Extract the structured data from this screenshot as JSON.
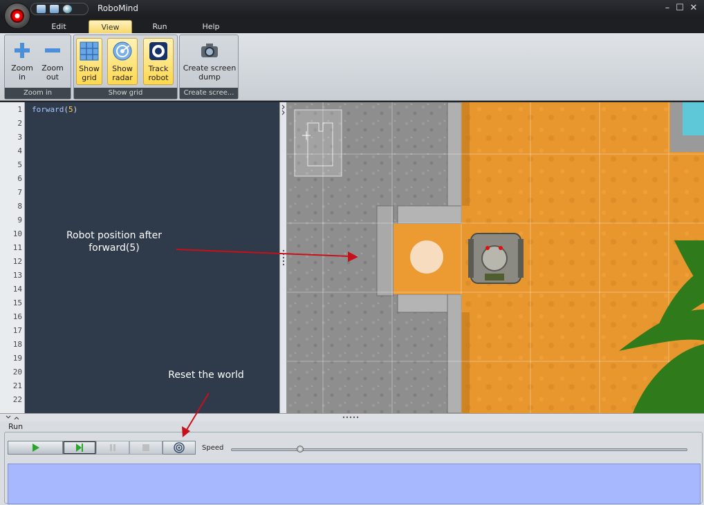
{
  "app": {
    "title": "RoboMind"
  },
  "window_controls": {
    "minimize": "–",
    "maximize": "☐",
    "close": "✕"
  },
  "menu": {
    "tabs": [
      "Edit",
      "View",
      "Run",
      "Help"
    ],
    "active": "View"
  },
  "ribbon": {
    "groups": [
      {
        "name": "Zoom in",
        "buttons": [
          {
            "label1": "Zoom",
            "label2": "in",
            "icon": "plus-icon"
          },
          {
            "label1": "Zoom",
            "label2": "out",
            "icon": "minus-icon"
          }
        ]
      },
      {
        "name": "Show grid",
        "buttons": [
          {
            "label1": "Show",
            "label2": "grid",
            "icon": "grid-icon",
            "active": true
          },
          {
            "label1": "Show",
            "label2": "radar",
            "icon": "radar-icon",
            "active": true
          },
          {
            "label1": "Track",
            "label2": "robot",
            "icon": "eye-icon",
            "active": true
          }
        ]
      },
      {
        "name": "Create scree...",
        "buttons": [
          {
            "label1": "Create screen",
            "label2": "dump",
            "icon": "camera-icon"
          }
        ]
      }
    ]
  },
  "editor": {
    "line_numbers": [
      "1",
      "2",
      "3",
      "4",
      "5",
      "6",
      "7",
      "8",
      "9",
      "10",
      "11",
      "12",
      "13",
      "14",
      "15",
      "16",
      "17",
      "18",
      "19",
      "20",
      "21",
      "22"
    ],
    "code": {
      "keyword": "forward",
      "open": "(",
      "arg": "5",
      "close": ")"
    }
  },
  "annotations": {
    "robot_position_line1": "Robot position after",
    "robot_position_line2": "forward(5)",
    "reset_world": "Reset the world"
  },
  "run_panel": {
    "label": "Run",
    "speed_label": "Speed",
    "speed_level": 0.15,
    "buttons": [
      "play-icon",
      "step-icon",
      "pause-icon",
      "stop-icon",
      "reset-world-icon"
    ]
  },
  "colors": {
    "accent": "#ffd84e",
    "editor_bg": "#2f3b4b",
    "output_bg": "#a8b8ff",
    "sand": "#e8972e",
    "concrete": "#8f8f8f",
    "arrow": "#c8101a"
  }
}
